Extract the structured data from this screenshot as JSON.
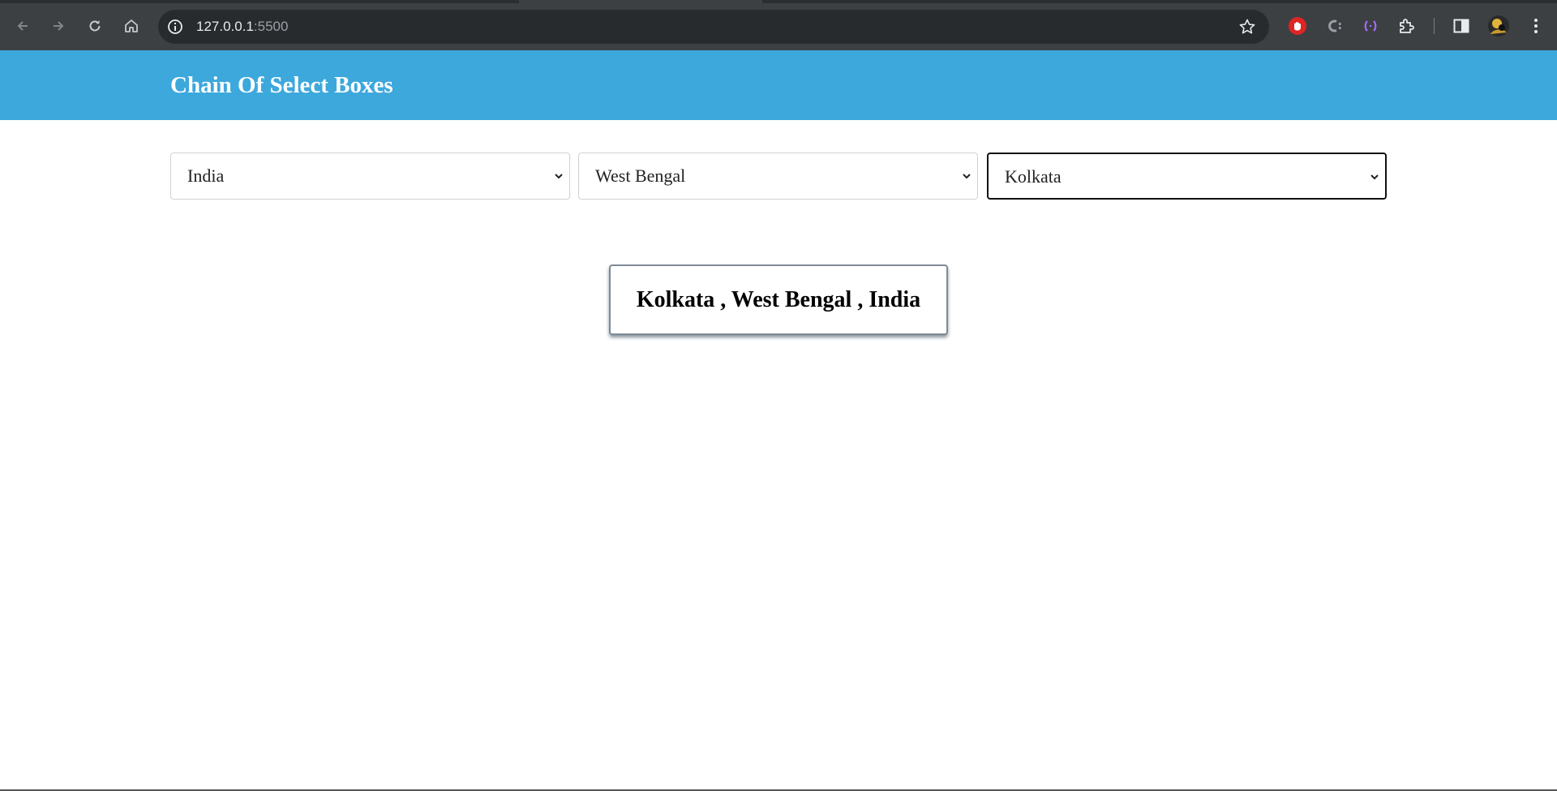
{
  "browser": {
    "url_host": "127.0.0.1",
    "url_port": ":5500",
    "icons": {
      "back": "back-arrow-icon",
      "forward": "forward-arrow-icon",
      "reload": "reload-icon",
      "home": "home-icon",
      "site_info": "info-icon",
      "bookmark": "star-icon",
      "extensions": "puzzle-icon",
      "side_panel": "side-panel-icon",
      "menu": "kebab-menu-icon"
    }
  },
  "page": {
    "title": "Chain Of Select Boxes",
    "header_color": "#3da8dc",
    "selects": {
      "country": {
        "value": "India"
      },
      "state": {
        "value": "West Bengal"
      },
      "city": {
        "value": "Kolkata"
      }
    },
    "result": "Kolkata , West Bengal , India"
  }
}
